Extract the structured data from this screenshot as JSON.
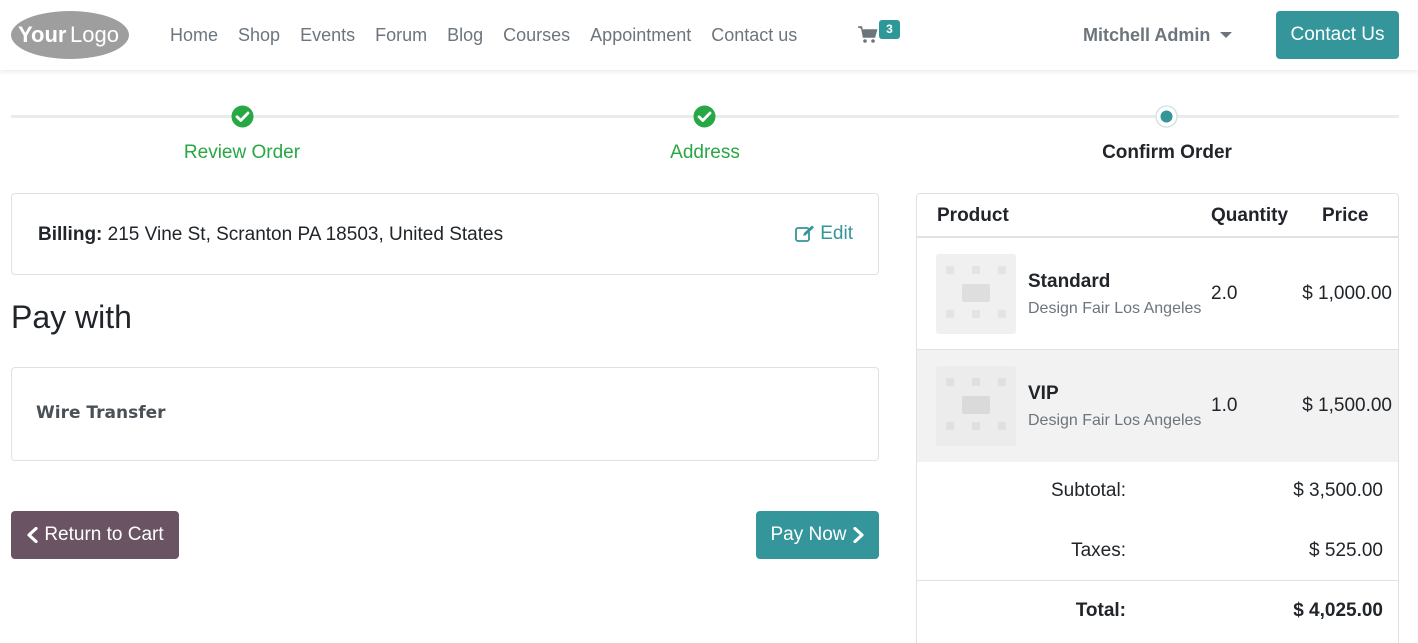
{
  "header": {
    "logo_text": "YourLogo",
    "nav": [
      "Home",
      "Shop",
      "Events",
      "Forum",
      "Blog",
      "Courses",
      "Appointment",
      "Contact us"
    ],
    "cart_count": "3",
    "user_name": "Mitchell Admin",
    "contact_button": "Contact Us"
  },
  "steps": [
    {
      "label": "Review Order",
      "state": "done"
    },
    {
      "label": "Address",
      "state": "done"
    },
    {
      "label": "Confirm Order",
      "state": "current"
    }
  ],
  "billing": {
    "label": "Billing:",
    "address": "215 Vine St, Scranton PA 18503, United States",
    "edit_label": "Edit"
  },
  "payment": {
    "title": "Pay with",
    "method": "Wire Transfer"
  },
  "buttons": {
    "return_label": "Return to Cart",
    "pay_label": "Pay Now"
  },
  "summary": {
    "headers": {
      "product": "Product",
      "quantity": "Quantity",
      "price": "Price"
    },
    "items": [
      {
        "name": "Standard",
        "event": "Design Fair Los Angeles",
        "quantity": "2.0",
        "price": "$ 1,000.00"
      },
      {
        "name": "VIP",
        "event": "Design Fair Los Angeles",
        "quantity": "1.0",
        "price": "$ 1,500.00"
      }
    ],
    "subtotal_label": "Subtotal:",
    "subtotal": "$ 3,500.00",
    "taxes_label": "Taxes:",
    "taxes": "$ 525.00",
    "total_label": "Total:",
    "total": "$ 4,025.00"
  },
  "colors": {
    "primary": "#34959a",
    "secondary": "#6a5463",
    "success": "#28a745"
  }
}
